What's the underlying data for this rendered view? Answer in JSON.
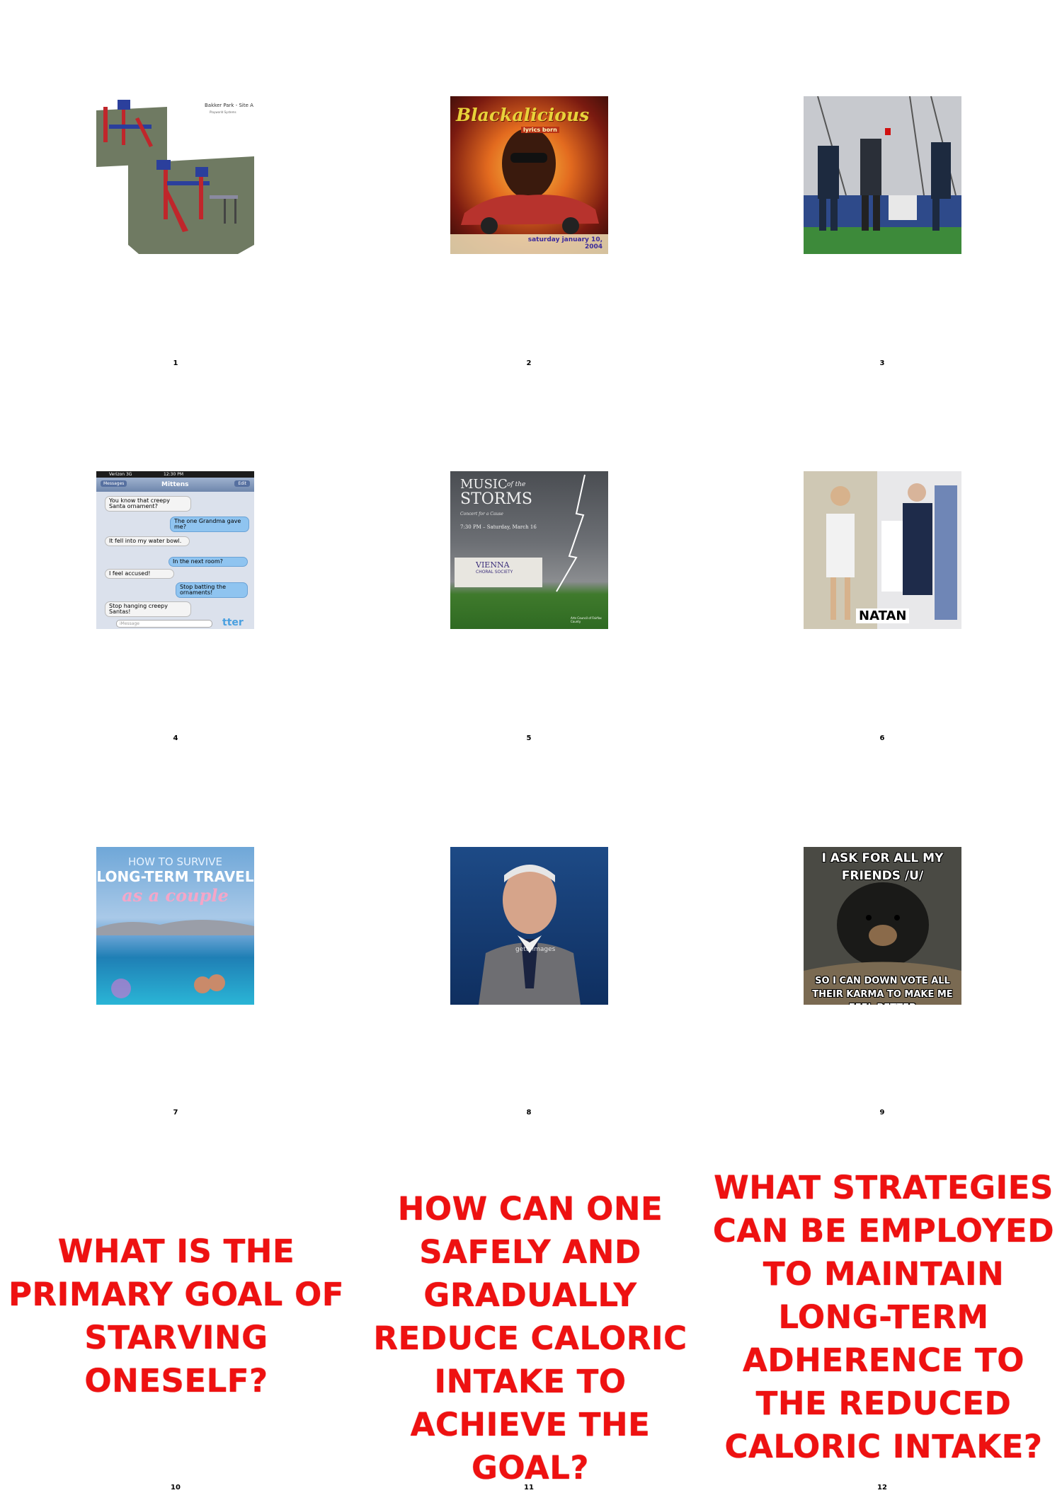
{
  "panels": [
    {
      "number": "1",
      "image": {
        "title": "Bakker Park - Site A",
        "subtitle": "Playworld Systems"
      }
    },
    {
      "number": "2",
      "image": {
        "title": "Blackalicious",
        "subtitle": "lyrics born",
        "bottom": "saturday january 10, 2004"
      }
    },
    {
      "number": "3"
    },
    {
      "number": "4",
      "image": {
        "carrier": "Verizon 3G",
        "time": "12:30 PM",
        "back": "Messages",
        "contact": "Mittens",
        "edit": "Edit",
        "messages": [
          {
            "side": "in",
            "text": "You know that creepy Santa ornament?"
          },
          {
            "side": "out",
            "text": "The one Grandma gave me?"
          },
          {
            "side": "in",
            "text": "It fell into my water bowl."
          },
          {
            "side": "out",
            "text": "In the next room?"
          },
          {
            "side": "in",
            "text": "I feel accused!"
          },
          {
            "side": "out",
            "text": "Stop batting the ornaments!"
          },
          {
            "side": "in",
            "text": "Stop hanging creepy Santas!"
          }
        ],
        "input_placeholder": "iMessage",
        "watermark": "tter"
      }
    },
    {
      "number": "5",
      "image": {
        "title_1": "MUSIC",
        "title_2": "of the",
        "title_3": "STORMS",
        "subtitle": "Concert for a Cause",
        "date": "7:30 PM – Saturday, March 16",
        "org": "VIENNA",
        "org_2": "CHORAL SOCIETY",
        "sponsor": "Arts Council of Fairfax County"
      }
    },
    {
      "number": "6",
      "image": {
        "label": "NATAN"
      }
    },
    {
      "number": "7",
      "image": {
        "line_1": "HOW TO SURVIVE",
        "line_2": "LONG-TERM TRAVEL",
        "line_3": "as a couple"
      }
    },
    {
      "number": "8",
      "image": {
        "watermark": "gettyimages"
      }
    },
    {
      "number": "9",
      "image": {
        "top": "I ASK FOR ALL MY FRIENDS /U/",
        "bottom": "SO I CAN DOWN VOTE ALL THEIR KARMA TO MAKE ME FEEL BETTER"
      }
    },
    {
      "number": "10",
      "question": "WHAT IS THE PRIMARY GOAL OF STARVING ONESELF?"
    },
    {
      "number": "11",
      "question": "HOW CAN ONE SAFELY AND GRADUALLY REDUCE CALORIC INTAKE TO ACHIEVE THE GOAL?"
    },
    {
      "number": "12",
      "question": "WHAT STRATEGIES CAN BE EMPLOYED TO MAINTAIN LONG-TERM ADHERENCE TO THE REDUCED CALORIC INTAKE?"
    }
  ],
  "colors": {
    "question_text": "#ee1111",
    "background": "#ffffff"
  }
}
